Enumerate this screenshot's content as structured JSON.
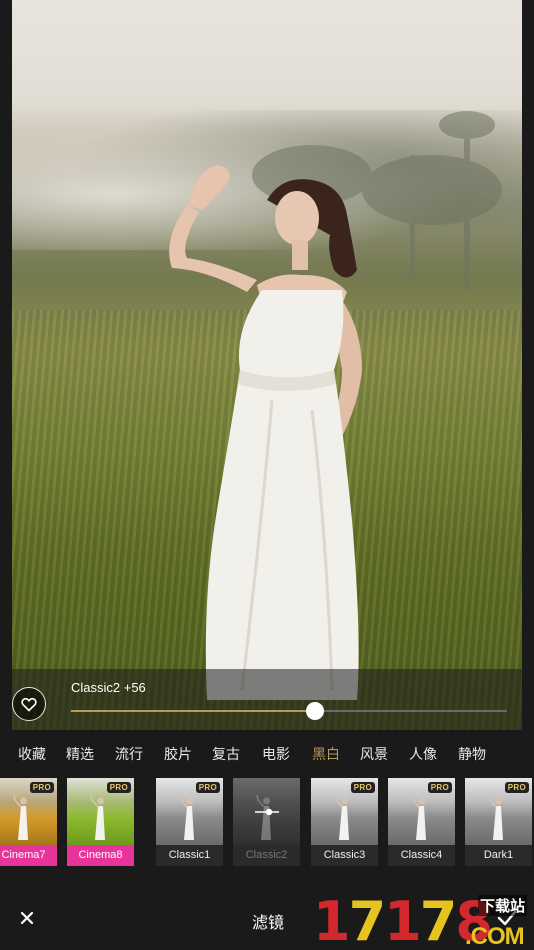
{
  "slider": {
    "label": "Classic2 +56",
    "value": 0.56
  },
  "categories": [
    "收藏",
    "精选",
    "流行",
    "胶片",
    "复古",
    "电影",
    "黑白",
    "风景",
    "人像",
    "静物"
  ],
  "active_category": "黑白",
  "colors": {
    "accent_gold": "#b59a5c",
    "active_pink": "#e8349a",
    "pro_gold": "#e6c76a"
  },
  "filters": [
    {
      "name": "Cinema7",
      "pro": "PRO",
      "style": "warm-color",
      "state": "active"
    },
    {
      "name": "Cinema8",
      "pro": "PRO",
      "style": "green-color",
      "state": "active"
    },
    {
      "name": "Classic1",
      "pro": "PRO",
      "style": "bw",
      "state": "normal"
    },
    {
      "name": "Classic2",
      "pro": "",
      "style": "bw-dark",
      "state": "selected"
    },
    {
      "name": "Classic3",
      "pro": "PRO",
      "style": "bw",
      "state": "normal"
    },
    {
      "name": "Classic4",
      "pro": "PRO",
      "style": "bw",
      "state": "normal"
    },
    {
      "name": "Dark1",
      "pro": "PRO",
      "style": "bw",
      "state": "normal"
    }
  ],
  "bottom_bar": {
    "title": "滤镜",
    "close_icon": "close-icon",
    "confirm_icon": "check-icon"
  },
  "watermark": {
    "number": "17178",
    "top_text": "下载站",
    "domain": ".COM"
  }
}
